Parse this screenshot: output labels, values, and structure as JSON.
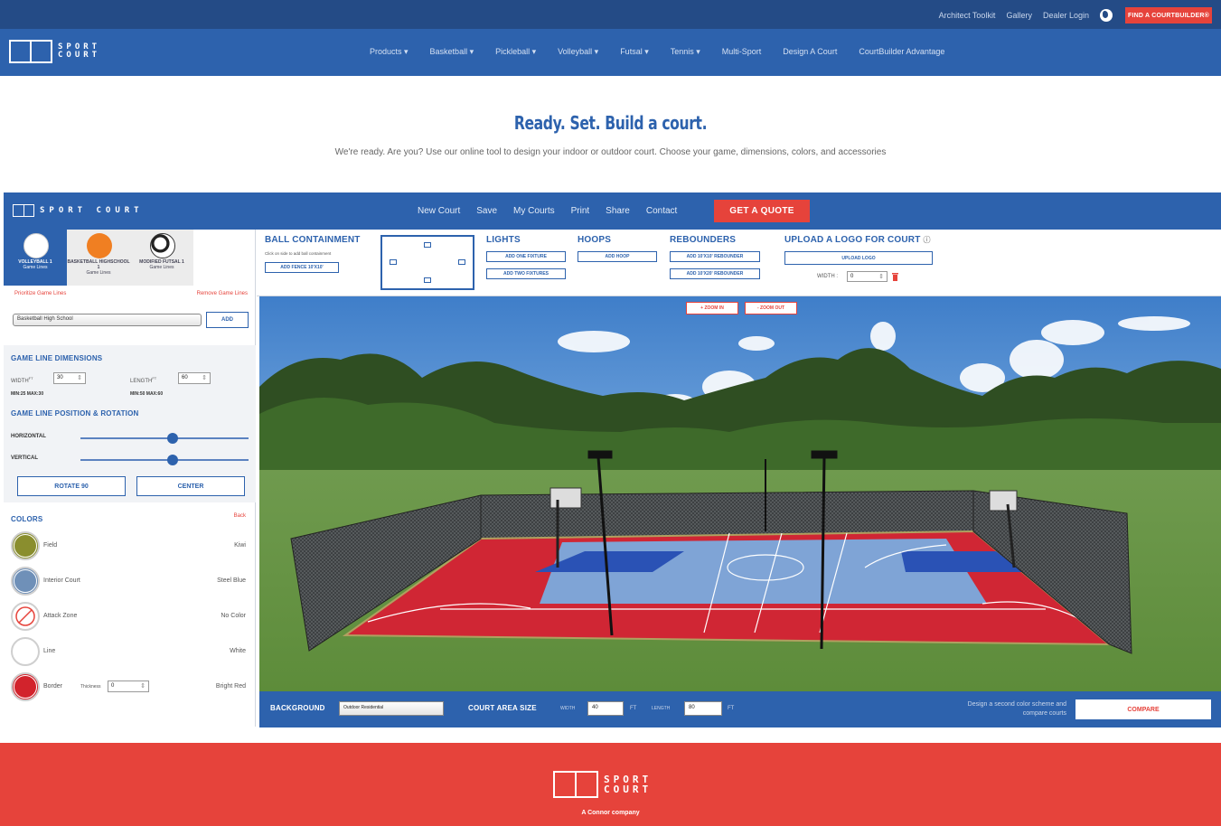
{
  "top_bar": {
    "links": [
      "Architect Toolkit",
      "Gallery",
      "Dealer Login"
    ],
    "find_button": "FIND A COURTBUILDER®"
  },
  "brand": {
    "line1": "SPORT",
    "line2": "COURT"
  },
  "main_nav": [
    "Products ▾",
    "Basketball ▾",
    "Pickleball ▾",
    "Volleyball ▾",
    "Futsal ▾",
    "Tennis ▾",
    "Multi-Sport",
    "Design A Court",
    "CourtBuilder Advantage"
  ],
  "hero": {
    "title": "Ready. Set. Build a court.",
    "subtitle": "We're ready. Are you? Use our online tool to design your indoor or outdoor court. Choose your game, dimensions, colors, and accessories"
  },
  "app_bar": {
    "brand": "SPORT COURT",
    "nav": [
      "New Court",
      "Save",
      "My Courts",
      "Print",
      "Share",
      "Contact"
    ],
    "quote_button": "GET A QUOTE"
  },
  "game_tabs": [
    {
      "name": "VOLLEYBALL 1",
      "sub": "Game Lines",
      "active": true
    },
    {
      "name": "BASKETBALL HIGHSCHOOL 1",
      "sub": "Game Lines",
      "active": false
    },
    {
      "name": "MODIFIED FUTSAL 1",
      "sub": "Game Lines",
      "active": false
    }
  ],
  "game_lines": {
    "prioritize": "Prioritize Game Lines",
    "remove": "Remove Game Lines",
    "select_value": "Basketball High School",
    "add_button": "ADD"
  },
  "dimensions": {
    "title": "GAME LINE DIMENSIONS",
    "width_label": "WIDTH",
    "width_value": "30",
    "width_range": "MIN:25 MAX:30",
    "length_label": "LENGTH",
    "length_value": "60",
    "length_range": "MIN:50 MAX:60",
    "unit": "FT"
  },
  "position": {
    "title": "GAME LINE POSITION & ROTATION",
    "horizontal_label": "HORIZONTAL",
    "horizontal_value": 0.55,
    "vertical_label": "VERTICAL",
    "vertical_value": 0.55,
    "rotate_button": "ROTATE 90",
    "center_button": "CENTER"
  },
  "colors": {
    "title": "COLORS",
    "back": "Back",
    "items": [
      {
        "label": "Field",
        "value": "Kiwi",
        "hex": "#8a8e2e"
      },
      {
        "label": "Interior Court",
        "value": "Steel Blue",
        "hex": "#6f90b8"
      },
      {
        "label": "Attack Zone",
        "value": "No Color",
        "hex": "none"
      },
      {
        "label": "Line",
        "value": "White",
        "hex": "#ffffff"
      },
      {
        "label": "Border",
        "value": "Bright Red",
        "hex": "#d2232c"
      }
    ],
    "thickness_label": "Thickness",
    "thickness_value": "0"
  },
  "tools": {
    "ball_containment": {
      "title": "BALL CONTAINMENT",
      "hint": "Click on side to add ball containment",
      "button": "ADD FENCE 10'X10'"
    },
    "lights": {
      "title": "LIGHTS",
      "buttons": [
        "ADD ONE FIXTURE",
        "ADD TWO FIXTURES"
      ]
    },
    "hoops": {
      "title": "HOOPS",
      "button": "ADD HOOP"
    },
    "rebounders": {
      "title": "REBOUNDERS",
      "buttons": [
        "ADD 10'X10' REBOUNDER",
        "ADD 10'X20' REBOUNDER"
      ]
    },
    "logo": {
      "title": "UPLOAD A LOGO FOR COURT",
      "button": "UPLOAD LOGO",
      "width_label": "WIDTH :",
      "width_value": "0"
    }
  },
  "scene": {
    "zoom_in": "+ ZOOM IN",
    "zoom_out": "- ZOOM OUT"
  },
  "bottom_bar": {
    "background_label": "BACKGROUND",
    "background_value": "Outdoor Residential",
    "area_label": "COURT AREA SIZE",
    "width_label": "WIDTH",
    "width_value": "40",
    "length_label": "LENGTH",
    "length_value": "80",
    "unit": "FT",
    "compare_text": "Design a second color scheme and compare courts",
    "compare_button": "COMPARE"
  },
  "footer": {
    "tagline": "A Connor company"
  }
}
